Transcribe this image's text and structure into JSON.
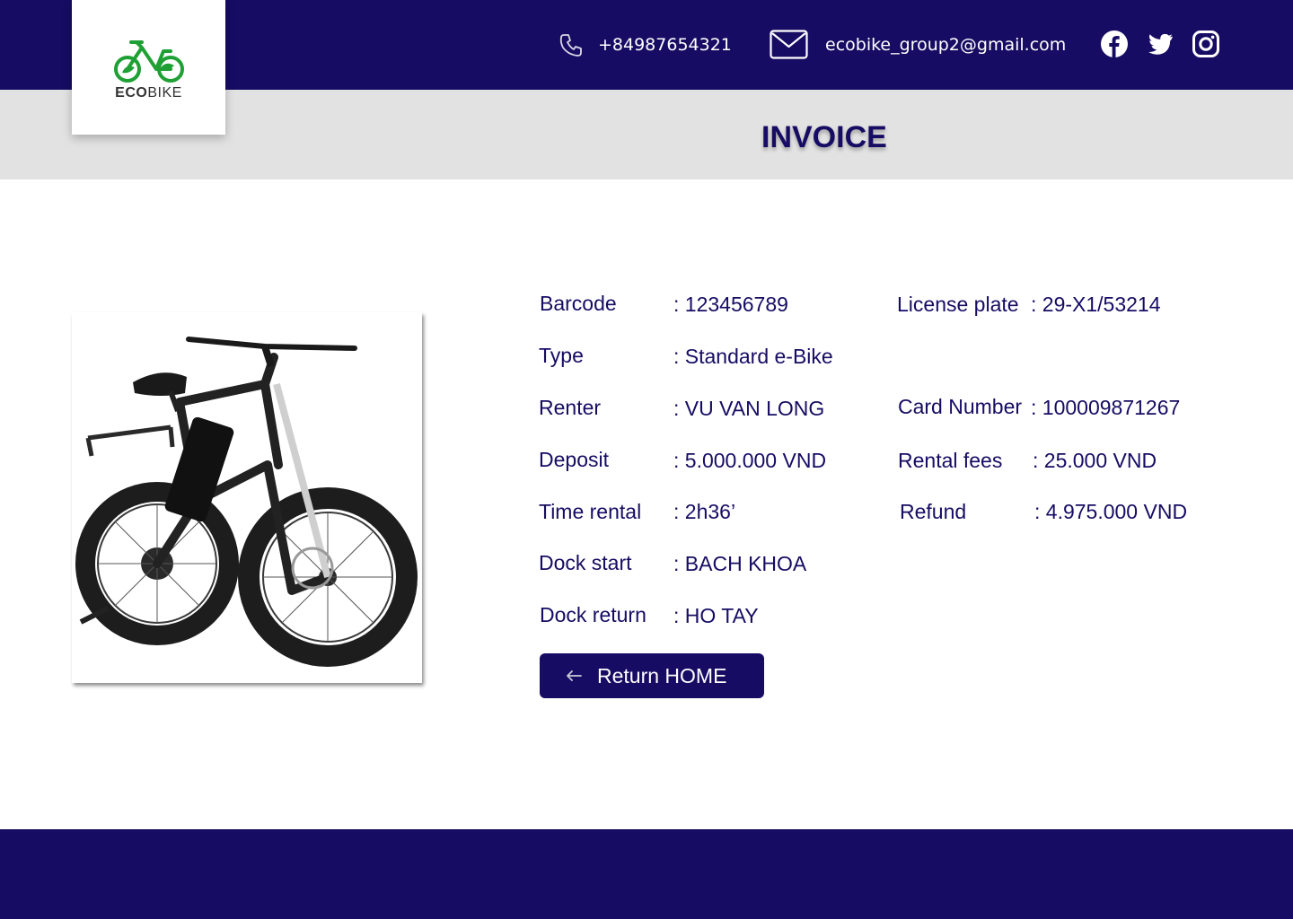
{
  "brand": {
    "name_eco": "ECO",
    "name_bike": "BIKE"
  },
  "header": {
    "phone": "+84987654321",
    "email": "ecobike_group2@gmail.com",
    "icons": [
      "phone-icon",
      "mail-icon",
      "facebook-icon",
      "twitter-icon",
      "instagram-icon"
    ]
  },
  "page": {
    "title": "INVOICE"
  },
  "invoice": {
    "barcode": {
      "label": "Barcode",
      "value": ": 123456789"
    },
    "type": {
      "label": "Type",
      "value": ": Standard e-Bike"
    },
    "renter": {
      "label": "Renter",
      "value": ": VU VAN LONG"
    },
    "deposit": {
      "label": "Deposit",
      "value": ": 5.000.000 VND"
    },
    "time_rental": {
      "label": "Time rental",
      "value": ": 2h36’"
    },
    "dock_start": {
      "label": "Dock start",
      "value": ": BACH KHOA"
    },
    "dock_return": {
      "label": "Dock return",
      "value": ": HO TAY"
    },
    "license_plate": {
      "label": "License plate",
      "value": ": 29-X1/53214"
    },
    "card_number": {
      "label": "Card Number",
      "value": ": 100009871267"
    },
    "rental_fees": {
      "label": "Rental fees",
      "value": ": 25.000 VND"
    },
    "refund": {
      "label": "Refund",
      "value": ": 4.975.000 VND"
    }
  },
  "actions": {
    "return_home": "Return HOME"
  },
  "colors": {
    "primary": "#160c63",
    "band": "#e3e2e2",
    "logo_green": "#1fa034"
  }
}
